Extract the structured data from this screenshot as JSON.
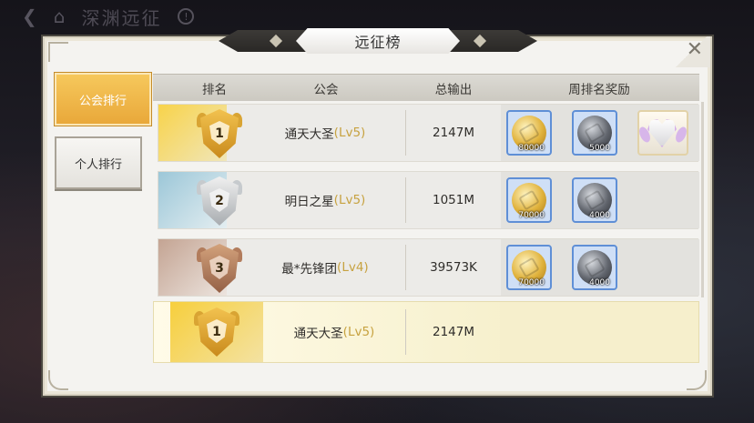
{
  "topbar": {
    "back_icon": "back-arrow-icon",
    "home_icon": "home-icon",
    "title": "深渊远征",
    "help_icon": "info-icon"
  },
  "dialog": {
    "title": "远征榜",
    "close_icon": "close-icon"
  },
  "tabs": [
    {
      "label": "公会排行",
      "active": true
    },
    {
      "label": "个人排行",
      "active": false
    }
  ],
  "table": {
    "headers": [
      "排名",
      "公会",
      "总输出",
      "周排名奖励"
    ],
    "rows": [
      {
        "rank": "1",
        "badge": "gold",
        "guild": "通天大圣",
        "level": "(Lv5)",
        "output": "2147M",
        "rewards": [
          {
            "type": "gold-coin",
            "qty": "80000"
          },
          {
            "type": "silver-coin",
            "qty": "5000"
          },
          {
            "type": "avatar-frame",
            "qty": ""
          }
        ]
      },
      {
        "rank": "2",
        "badge": "silver",
        "guild": "明日之星",
        "level": "(Lv5)",
        "output": "1051M",
        "rewards": [
          {
            "type": "gold-coin",
            "qty": "70000"
          },
          {
            "type": "silver-coin",
            "qty": "4000"
          }
        ]
      },
      {
        "rank": "3",
        "badge": "bronze",
        "guild": "最*先锋团",
        "level": "(Lv4)",
        "output": "39573K",
        "rewards": [
          {
            "type": "gold-coin",
            "qty": "70000"
          },
          {
            "type": "silver-coin",
            "qty": "4000"
          }
        ]
      }
    ]
  },
  "my_row": {
    "rank": "1",
    "badge": "gold",
    "guild": "通天大圣",
    "level": "(Lv5)",
    "output": "2147M"
  },
  "colors": {
    "accent_gold": "#e9a83a",
    "level_text": "#c7a240",
    "reward_border": "#5f8fd6"
  }
}
